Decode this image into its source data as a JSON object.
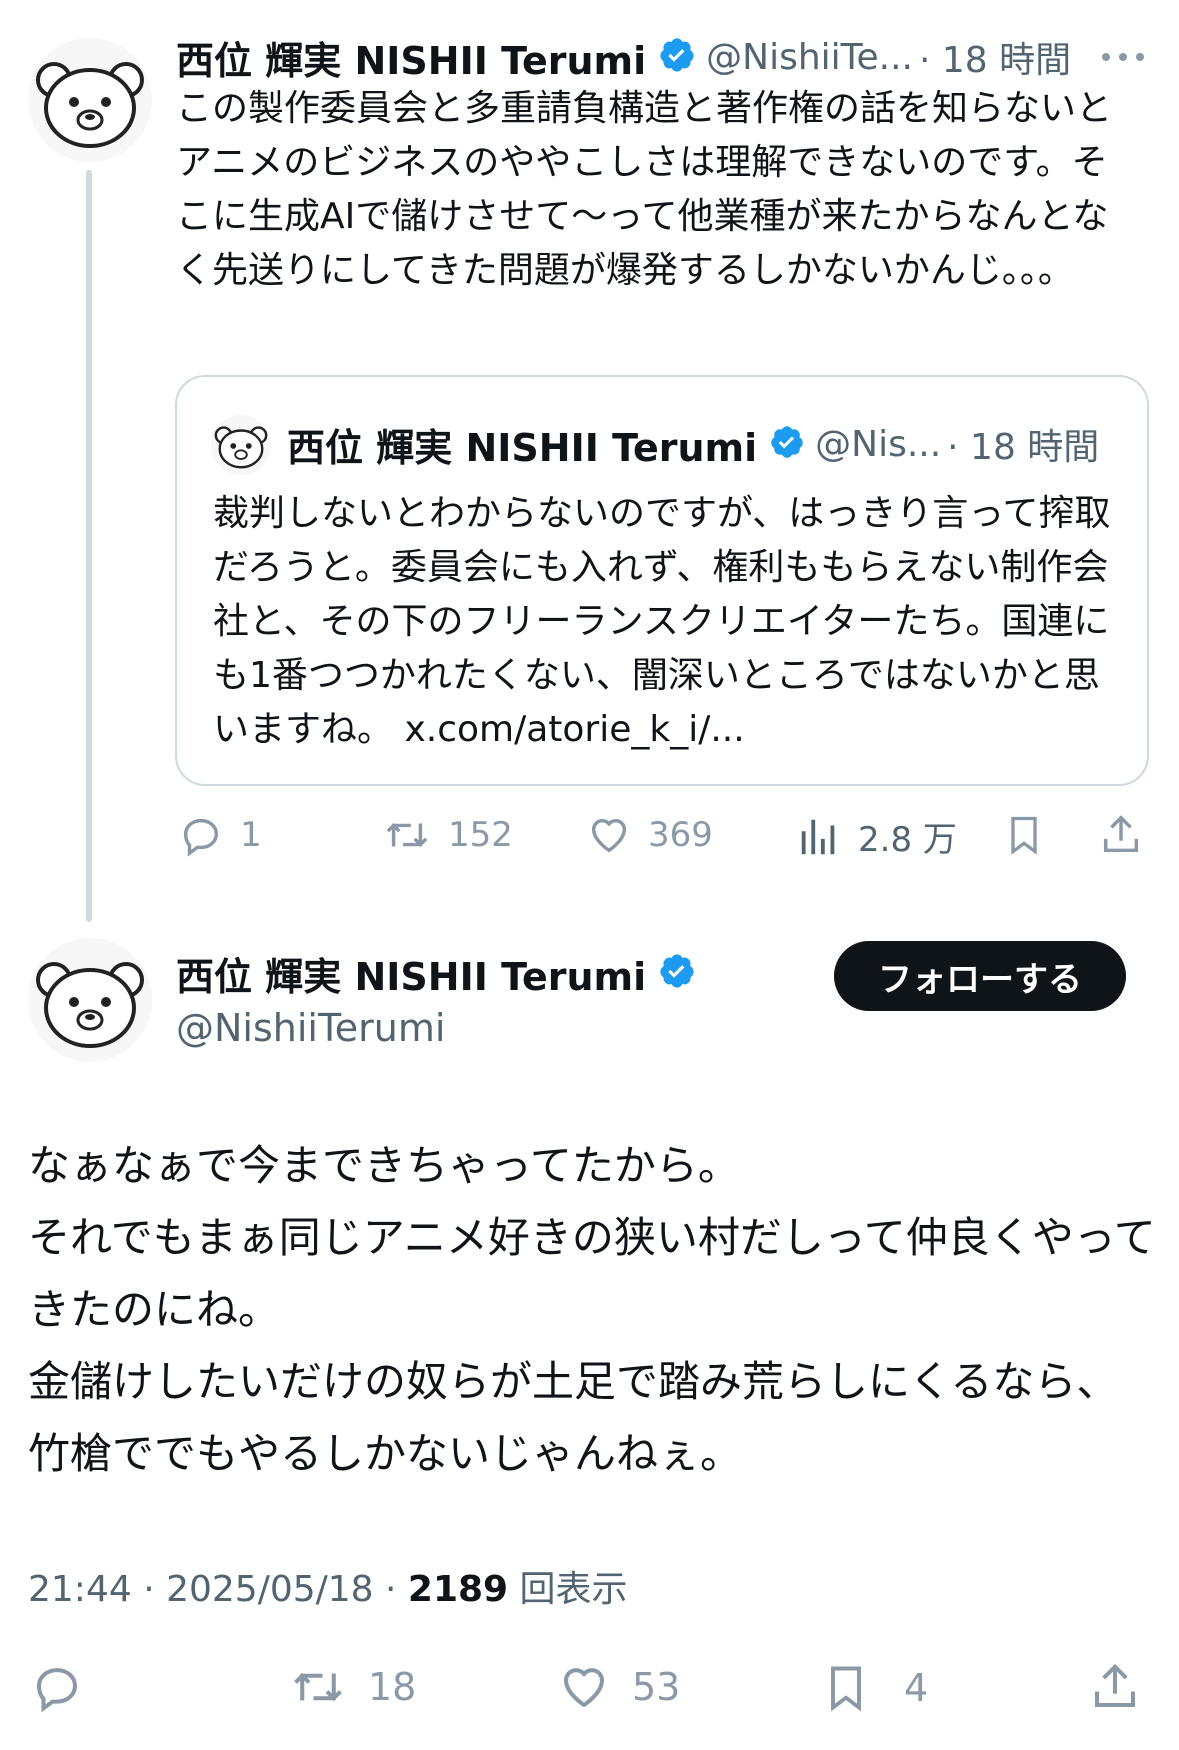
{
  "tweet1": {
    "name": "西位 輝実 NISHII Terumi",
    "handle": "@NishiiTe...",
    "time": "· 18 時間",
    "more_icon": "more-icon",
    "text": "この製作委員会と多重請負構造と著作権の話を知らないとアニメのビジネスのややこしさは理解できないのです。そこに生成AIで儲けさせて〜って他業種が来たからなんとなく先送りにしてきた問題が爆発するしかないかんじ。。。",
    "quote": {
      "name": "西位 輝実 NISHII Terumi",
      "handle": "@Nis...",
      "time": "· 18 時間",
      "text": "裁判しないとわからないのですが、はっきり言って搾取だろうと。委員会にも入れず、権利ももらえない制作会社と、その下のフリーランスクリエイターたち。国連にも1番つつかれたくない、闇深いところではないかと思いますね。 x.com/atorie_k_i/..."
    },
    "actions": {
      "replies": "1",
      "retweets": "152",
      "likes": "369",
      "views": "2.8 万"
    }
  },
  "tweet2": {
    "name": "西位 輝実 NISHII Terumi",
    "handle": "@NishiiTerumi",
    "follow_label": "フォローする",
    "text_lines": [
      "なぁなぁで今まできちゃってたから。",
      "それでもまぁ同じアニメ好きの狭い村だしって仲良くやってきたのにね。",
      "金儲けしたいだけの奴らが土足で踏み荒らしにくるなら、竹槍ででもやるしかないじゃんねぇ。"
    ],
    "meta": {
      "time": "21:44 · 2025/05/18 · ",
      "views": "2189",
      "views_label": " 回表示"
    },
    "actions": {
      "replies": "",
      "retweets": "18",
      "likes": "53",
      "bookmarks": "4"
    }
  },
  "colors": {
    "verified": "#1d9bf0",
    "text": "#0f1419",
    "secondary": "#536471",
    "icon": "#8b98a5"
  }
}
